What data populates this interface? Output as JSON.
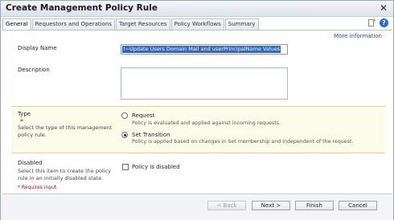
{
  "dialog": {
    "title": "Create Management Policy Rule",
    "close_glyph": "✕"
  },
  "tabs": [
    {
      "label": "General",
      "active": true
    },
    {
      "label": "Requestors and Operations",
      "active": false
    },
    {
      "label": "Target Resources",
      "active": false
    },
    {
      "label": "Policy Workflows",
      "active": false
    },
    {
      "label": "Summary",
      "active": false
    }
  ],
  "toolbar_icons": [
    "new-item-icon",
    "help-icon"
  ],
  "more_info": "More information",
  "display_name": {
    "label": "Display Name",
    "value": "!~Update Users Domain Mail and userPrincipalName Values"
  },
  "description": {
    "label": "Description",
    "value": ""
  },
  "type": {
    "label": "Type",
    "required_mark": "*",
    "help": "Select the type of this management policy rule.",
    "options": [
      {
        "label": "Request",
        "desc": "Policy is evaluated and applied against incoming requests.",
        "checked": false
      },
      {
        "label": "Set Transition",
        "desc": "Policy is applied based on changes in Set membership and independent of the request.",
        "checked": true
      }
    ]
  },
  "disabled": {
    "label": "Disabled",
    "help": "Select this item to create the policy rule in an initially disabled state.",
    "checkbox_label": "Policy is disabled",
    "checked": false
  },
  "requires_input": "* Requires input",
  "buttons": {
    "back": "< Back",
    "next": "Next >",
    "finish": "Finish",
    "cancel": "Cancel"
  },
  "colors": {
    "selection": "#3169c6",
    "link": "#1b4fa8",
    "type_section_bg": "#fdfbea",
    "required": "#cc0000"
  }
}
